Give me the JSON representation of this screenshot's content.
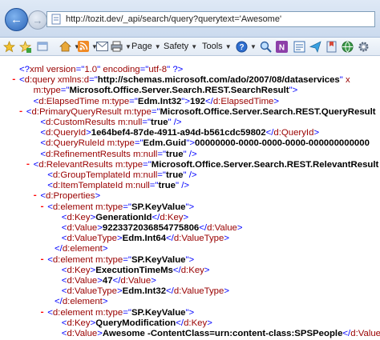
{
  "browser": {
    "url": "http://tozit.dev/_api/search/query?querytext='Awesome'",
    "toolbar": {
      "page_label": "Page",
      "safety_label": "Safety",
      "tools_label": "Tools",
      "help_label": "?"
    }
  },
  "xml_lines": [
    {
      "indent": 0,
      "marker": "",
      "parts": [
        [
          "b",
          "<?"
        ],
        [
          "t",
          "xml version"
        ],
        [
          "b",
          "=\""
        ],
        [
          "t",
          "1.0"
        ],
        [
          "b",
          "\" "
        ],
        [
          "t",
          "encoding"
        ],
        [
          "b",
          "=\""
        ],
        [
          "t",
          "utf-8"
        ],
        [
          "b",
          "\" ?>"
        ]
      ]
    },
    {
      "indent": 0,
      "marker": "-",
      "parts": [
        [
          "b",
          "<"
        ],
        [
          "t",
          "d:query "
        ],
        [
          "a",
          "xmlns:d"
        ],
        [
          "b",
          "=\""
        ],
        [
          "x",
          "http://schemas.microsoft.com/ado/2007/08/dataservices"
        ],
        [
          "b",
          "\" "
        ],
        [
          "a",
          "x"
        ]
      ]
    },
    {
      "indent": 2,
      "marker": "",
      "parts": [
        [
          "a",
          "m:type"
        ],
        [
          "b",
          "=\""
        ],
        [
          "x",
          "Microsoft.Office.Server.Search.REST.SearchResult"
        ],
        [
          "b",
          "\">"
        ]
      ]
    },
    {
      "indent": 2,
      "marker": "",
      "parts": [
        [
          "b",
          "<"
        ],
        [
          "t",
          "d:ElapsedTime "
        ],
        [
          "a",
          "m:type"
        ],
        [
          "b",
          "=\""
        ],
        [
          "x",
          "Edm.Int32"
        ],
        [
          "b",
          "\">"
        ],
        [
          "v",
          "192"
        ],
        [
          "b",
          "</"
        ],
        [
          "t",
          "d:ElapsedTime"
        ],
        [
          "b",
          ">"
        ]
      ]
    },
    {
      "indent": 1,
      "marker": "-",
      "parts": [
        [
          "b",
          "<"
        ],
        [
          "t",
          "d:PrimaryQueryResult "
        ],
        [
          "a",
          "m:type"
        ],
        [
          "b",
          "=\""
        ],
        [
          "x",
          "Microsoft.Office.Server.Search.REST.QueryResult"
        ]
      ]
    },
    {
      "indent": 3,
      "marker": "",
      "parts": [
        [
          "b",
          "<"
        ],
        [
          "t",
          "d:CustomResults "
        ],
        [
          "a",
          "m:null"
        ],
        [
          "b",
          "=\""
        ],
        [
          "x",
          "true"
        ],
        [
          "b",
          "\" />"
        ]
      ]
    },
    {
      "indent": 3,
      "marker": "",
      "parts": [
        [
          "b",
          "<"
        ],
        [
          "t",
          "d:QueryId"
        ],
        [
          "b",
          ">"
        ],
        [
          "v",
          "1e64bef4-87de-4911-a94d-b561cdc59802"
        ],
        [
          "b",
          "</"
        ],
        [
          "t",
          "d:QueryId"
        ],
        [
          "b",
          ">"
        ]
      ]
    },
    {
      "indent": 3,
      "marker": "",
      "parts": [
        [
          "b",
          "<"
        ],
        [
          "t",
          "d:QueryRuleId "
        ],
        [
          "a",
          "m:type"
        ],
        [
          "b",
          "=\""
        ],
        [
          "x",
          "Edm.Guid"
        ],
        [
          "b",
          "\">"
        ],
        [
          "v",
          "00000000-0000-0000-0000-000000000000"
        ]
      ]
    },
    {
      "indent": 3,
      "marker": "",
      "parts": [
        [
          "b",
          "<"
        ],
        [
          "t",
          "d:RefinementResults "
        ],
        [
          "a",
          "m:null"
        ],
        [
          "b",
          "=\""
        ],
        [
          "x",
          "true"
        ],
        [
          "b",
          "\" />"
        ]
      ]
    },
    {
      "indent": 2,
      "marker": "-",
      "parts": [
        [
          "b",
          "<"
        ],
        [
          "t",
          "d:RelevantResults "
        ],
        [
          "a",
          "m:type"
        ],
        [
          "b",
          "=\""
        ],
        [
          "x",
          "Microsoft.Office.Server.Search.REST.RelevantResult"
        ]
      ]
    },
    {
      "indent": 4,
      "marker": "",
      "parts": [
        [
          "b",
          "<"
        ],
        [
          "t",
          "d:GroupTemplateId "
        ],
        [
          "a",
          "m:null"
        ],
        [
          "b",
          "=\""
        ],
        [
          "x",
          "true"
        ],
        [
          "b",
          "\" />"
        ]
      ]
    },
    {
      "indent": 4,
      "marker": "",
      "parts": [
        [
          "b",
          "<"
        ],
        [
          "t",
          "d:ItemTemplateId "
        ],
        [
          "a",
          "m:null"
        ],
        [
          "b",
          "=\""
        ],
        [
          "x",
          "true"
        ],
        [
          "b",
          "\" />"
        ]
      ]
    },
    {
      "indent": 3,
      "marker": "-",
      "parts": [
        [
          "b",
          "<"
        ],
        [
          "t",
          "d:Properties"
        ],
        [
          "b",
          ">"
        ]
      ]
    },
    {
      "indent": 4,
      "marker": "-",
      "parts": [
        [
          "b",
          "<"
        ],
        [
          "t",
          "d:element "
        ],
        [
          "a",
          "m:type"
        ],
        [
          "b",
          "=\""
        ],
        [
          "x",
          "SP.KeyValue"
        ],
        [
          "b",
          "\">"
        ]
      ]
    },
    {
      "indent": 6,
      "marker": "",
      "parts": [
        [
          "b",
          "<"
        ],
        [
          "t",
          "d:Key"
        ],
        [
          "b",
          ">"
        ],
        [
          "v",
          "GenerationId"
        ],
        [
          "b",
          "</"
        ],
        [
          "t",
          "d:Key"
        ],
        [
          "b",
          ">"
        ]
      ]
    },
    {
      "indent": 6,
      "marker": "",
      "parts": [
        [
          "b",
          "<"
        ],
        [
          "t",
          "d:Value"
        ],
        [
          "b",
          ">"
        ],
        [
          "v",
          "9223372036854775806"
        ],
        [
          "b",
          "</"
        ],
        [
          "t",
          "d:Value"
        ],
        [
          "b",
          ">"
        ]
      ]
    },
    {
      "indent": 6,
      "marker": "",
      "parts": [
        [
          "b",
          "<"
        ],
        [
          "t",
          "d:ValueType"
        ],
        [
          "b",
          ">"
        ],
        [
          "v",
          "Edm.Int64"
        ],
        [
          "b",
          "</"
        ],
        [
          "t",
          "d:ValueType"
        ],
        [
          "b",
          ">"
        ]
      ]
    },
    {
      "indent": 5,
      "marker": "",
      "parts": [
        [
          "b",
          "</"
        ],
        [
          "t",
          "d:element"
        ],
        [
          "b",
          ">"
        ]
      ]
    },
    {
      "indent": 4,
      "marker": "-",
      "parts": [
        [
          "b",
          "<"
        ],
        [
          "t",
          "d:element "
        ],
        [
          "a",
          "m:type"
        ],
        [
          "b",
          "=\""
        ],
        [
          "x",
          "SP.KeyValue"
        ],
        [
          "b",
          "\">"
        ]
      ]
    },
    {
      "indent": 6,
      "marker": "",
      "parts": [
        [
          "b",
          "<"
        ],
        [
          "t",
          "d:Key"
        ],
        [
          "b",
          ">"
        ],
        [
          "v",
          "ExecutionTimeMs"
        ],
        [
          "b",
          "</"
        ],
        [
          "t",
          "d:Key"
        ],
        [
          "b",
          ">"
        ]
      ]
    },
    {
      "indent": 6,
      "marker": "",
      "parts": [
        [
          "b",
          "<"
        ],
        [
          "t",
          "d:Value"
        ],
        [
          "b",
          ">"
        ],
        [
          "v",
          "47"
        ],
        [
          "b",
          "</"
        ],
        [
          "t",
          "d:Value"
        ],
        [
          "b",
          ">"
        ]
      ]
    },
    {
      "indent": 6,
      "marker": "",
      "parts": [
        [
          "b",
          "<"
        ],
        [
          "t",
          "d:ValueType"
        ],
        [
          "b",
          ">"
        ],
        [
          "v",
          "Edm.Int32"
        ],
        [
          "b",
          "</"
        ],
        [
          "t",
          "d:ValueType"
        ],
        [
          "b",
          ">"
        ]
      ]
    },
    {
      "indent": 5,
      "marker": "",
      "parts": [
        [
          "b",
          "</"
        ],
        [
          "t",
          "d:element"
        ],
        [
          "b",
          ">"
        ]
      ]
    },
    {
      "indent": 4,
      "marker": "-",
      "parts": [
        [
          "b",
          "<"
        ],
        [
          "t",
          "d:element "
        ],
        [
          "a",
          "m:type"
        ],
        [
          "b",
          "=\""
        ],
        [
          "x",
          "SP.KeyValue"
        ],
        [
          "b",
          "\">"
        ]
      ]
    },
    {
      "indent": 6,
      "marker": "",
      "parts": [
        [
          "b",
          "<"
        ],
        [
          "t",
          "d:Key"
        ],
        [
          "b",
          ">"
        ],
        [
          "v",
          "QueryModification"
        ],
        [
          "b",
          "</"
        ],
        [
          "t",
          "d:Key"
        ],
        [
          "b",
          ">"
        ]
      ]
    },
    {
      "indent": 6,
      "marker": "",
      "parts": [
        [
          "b",
          "<"
        ],
        [
          "t",
          "d:Value"
        ],
        [
          "b",
          ">"
        ],
        [
          "v",
          "Awesome -ContentClass=urn:content-class:SPSPeople"
        ],
        [
          "b",
          "</"
        ],
        [
          "t",
          "d:Value"
        ],
        [
          "b",
          ">"
        ]
      ]
    }
  ]
}
